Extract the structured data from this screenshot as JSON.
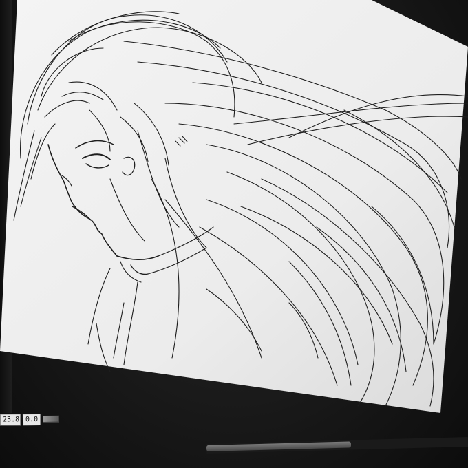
{
  "status": {
    "zoom_value": "23.8",
    "angle_value": "0.0"
  },
  "icons": {
    "scroll_thumb": "horizontal-scrollbar-thumb"
  }
}
